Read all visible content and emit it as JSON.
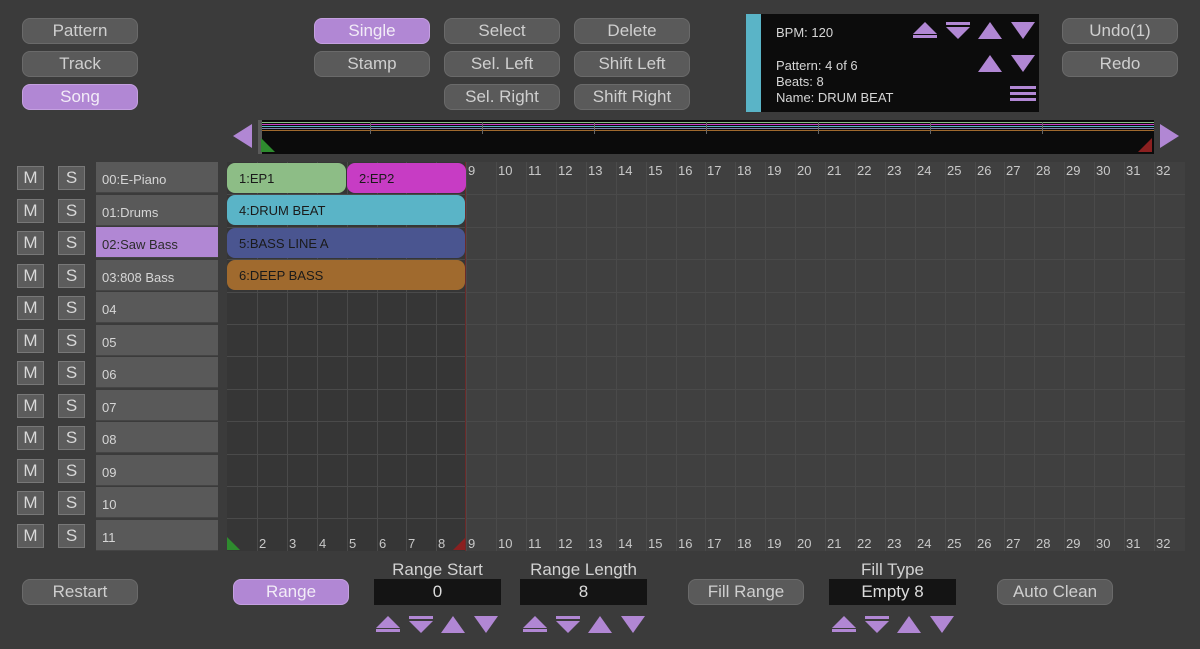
{
  "view_mode": {
    "pattern": "Pattern",
    "track": "Track",
    "song": "Song"
  },
  "edit_mode": {
    "single": "Single",
    "stamp": "Stamp",
    "select": "Select",
    "sel_left": "Sel. Left",
    "sel_right": "Sel. Right",
    "delete": "Delete",
    "shift_left": "Shift Left",
    "shift_right": "Shift Right"
  },
  "info": {
    "bpm": "BPM: 120",
    "pattern": "Pattern: 4 of 6",
    "beats": "Beats: 8",
    "name": "Name: DRUM BEAT",
    "stripe_color": "#5ab4c7"
  },
  "history": {
    "undo": "Undo(1)",
    "redo": "Redo"
  },
  "tracks": [
    {
      "label": "00:E-Piano"
    },
    {
      "label": "01:Drums"
    },
    {
      "label": "02:Saw Bass"
    },
    {
      "label": "03:808 Bass"
    },
    {
      "label": "04"
    },
    {
      "label": "05"
    },
    {
      "label": "06"
    },
    {
      "label": "07"
    },
    {
      "label": "08"
    },
    {
      "label": "09"
    },
    {
      "label": "10"
    },
    {
      "label": "11"
    }
  ],
  "track_buttons": {
    "mute": "M",
    "solo": "S"
  },
  "selected_track": 2,
  "clips": [
    {
      "label": "1:EP1",
      "color": "#8dbd86"
    },
    {
      "label": "2:EP2",
      "color": "#c73cc4"
    },
    {
      "label": "4:DRUM BEAT",
      "color": "#5ab4c7"
    },
    {
      "label": "5:BASS LINE A",
      "color": "#4a5590"
    },
    {
      "label": "6:DEEP BASS",
      "color": "#a06a2e"
    }
  ],
  "beat_numbers": [
    "9",
    "10",
    "11",
    "12",
    "13",
    "14",
    "15",
    "16",
    "17",
    "18",
    "19",
    "20",
    "21",
    "22",
    "23",
    "24",
    "25",
    "26",
    "27",
    "28",
    "29",
    "30",
    "31",
    "32"
  ],
  "bottom_numbers": [
    "2",
    "3",
    "4",
    "5",
    "6",
    "7",
    "8",
    "9",
    "10",
    "11",
    "12",
    "13",
    "14",
    "15",
    "16",
    "17",
    "18",
    "19",
    "20",
    "21",
    "22",
    "23",
    "24",
    "25",
    "26",
    "27",
    "28",
    "29",
    "30",
    "31",
    "32"
  ],
  "bottom": {
    "restart": "Restart",
    "range": "Range",
    "range_start_label": "Range Start",
    "range_start": "0",
    "range_length_label": "Range Length",
    "range_length": "8",
    "fill_range": "Fill Range",
    "fill_type_label": "Fill Type",
    "fill_type": "Empty 8",
    "auto_clean": "Auto Clean"
  },
  "accent_color": "#b187d4"
}
